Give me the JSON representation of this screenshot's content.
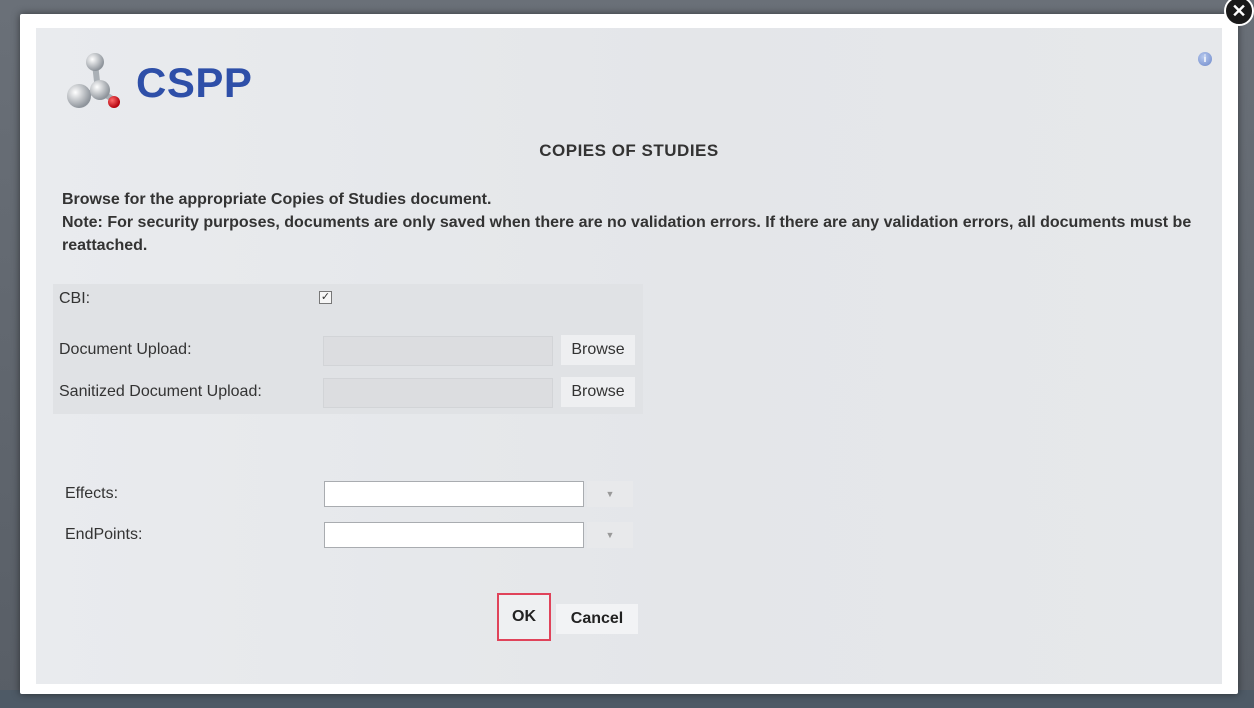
{
  "app": {
    "logo_text": "CSPP"
  },
  "dialog": {
    "title": "COPIES OF STUDIES",
    "instruction_line1": "Browse for the appropriate Copies of Studies document.",
    "instruction_line2": "Note: For security purposes, documents are only saved when there are no validation errors. If there are any validation errors, all documents must be reattached."
  },
  "form": {
    "cbi_label": "CBI:",
    "cbi_checked": true,
    "cbi_check_glyph": "✓",
    "document_upload_label": "Document Upload:",
    "sanitized_upload_label": "Sanitized Document Upload:",
    "browse_label": "Browse",
    "effects_label": "Effects:",
    "effects_value": "",
    "endpoints_label": "EndPoints:",
    "endpoints_value": "",
    "dropdown_glyph": "▼"
  },
  "buttons": {
    "ok_label": "OK",
    "cancel_label": "Cancel",
    "close_glyph": "✕",
    "help_glyph": "i"
  },
  "colors": {
    "brand": "#2e4fa8",
    "ok_border": "#e0435a"
  }
}
